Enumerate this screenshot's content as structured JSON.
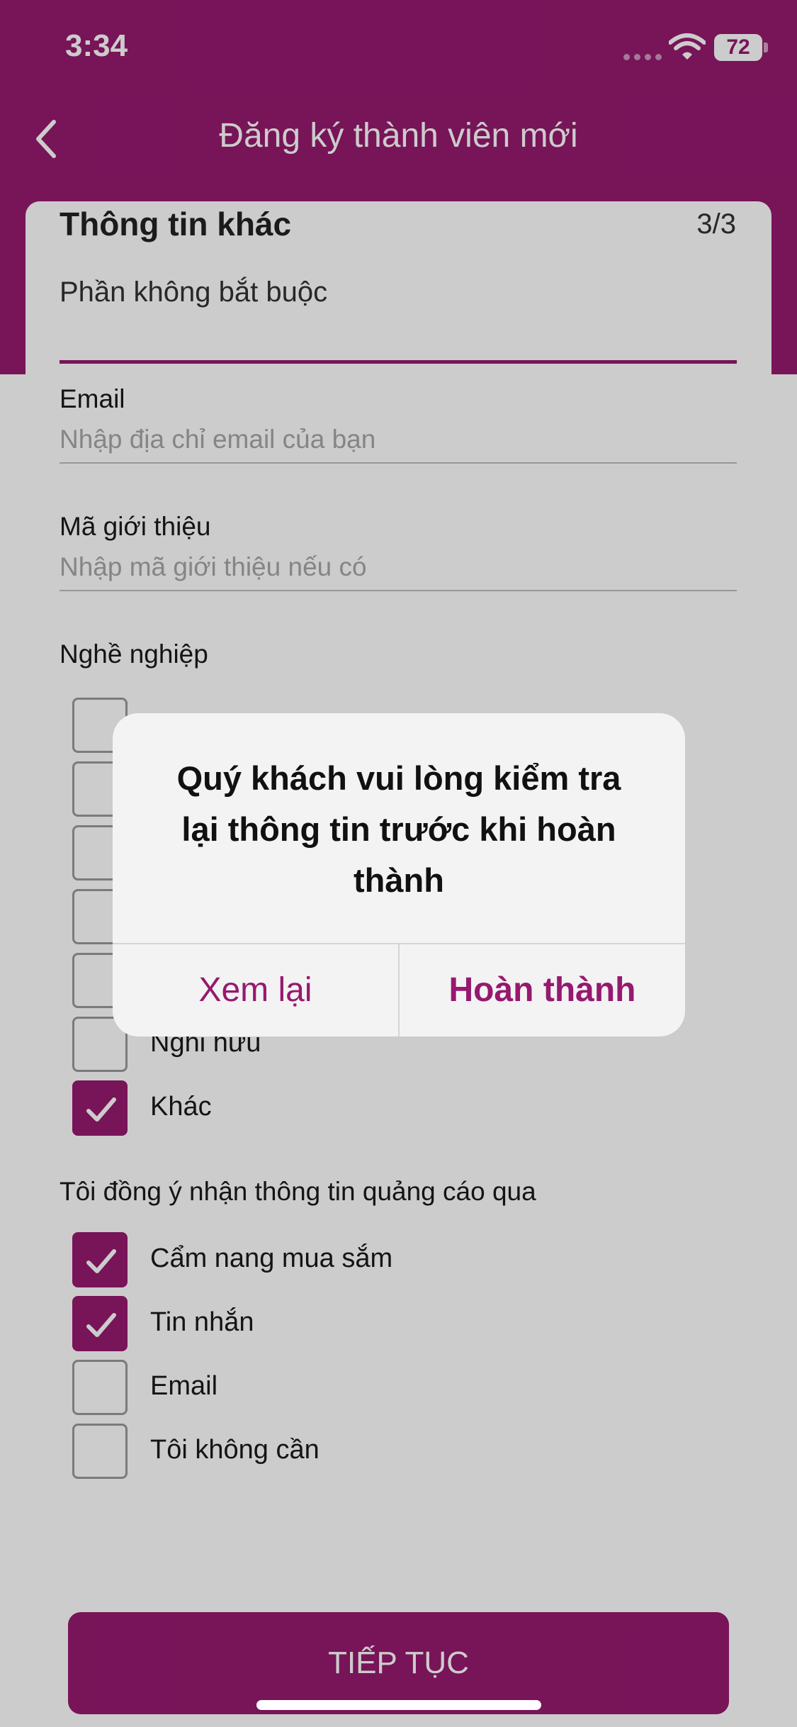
{
  "colors": {
    "brand": "#96196f",
    "overlay": "rgba(0,0,0,0.2)"
  },
  "status_bar": {
    "time": "3:34",
    "battery": "72"
  },
  "nav": {
    "back_icon": "chevron-left-icon",
    "title": "Đăng ký thành viên mới"
  },
  "card": {
    "title": "Thông tin khác",
    "step": "3/3",
    "subtitle": "Phần không bắt buộc",
    "email": {
      "label": "Email",
      "placeholder": "Nhập địa chỉ email của bạn",
      "value": ""
    },
    "referral": {
      "label": "Mã giới thiệu",
      "placeholder": "Nhập mã giới thiệu nếu có",
      "value": ""
    },
    "occupation": {
      "label": "Nghề nghiệp",
      "options": [
        {
          "label": "",
          "checked": false
        },
        {
          "label": "",
          "checked": false
        },
        {
          "label": "",
          "checked": false
        },
        {
          "label": "",
          "checked": false
        },
        {
          "label": "",
          "checked": false
        },
        {
          "label": "Nghỉ hưu",
          "checked": false
        },
        {
          "label": "Khác",
          "checked": true
        }
      ]
    },
    "ads": {
      "label": "Tôi đồng ý nhận thông tin quảng cáo qua",
      "options": [
        {
          "label": "Cẩm nang mua sắm",
          "checked": true
        },
        {
          "label": "Tin nhắn",
          "checked": true
        },
        {
          "label": "Email",
          "checked": false
        },
        {
          "label": "Tôi không cần",
          "checked": false
        }
      ]
    }
  },
  "footer": {
    "continue_label": "TIẾP TỤC"
  },
  "alert": {
    "message": "Quý khách vui lòng kiểm tra lại thông tin trước khi hoàn thành",
    "review_label": "Xem lại",
    "complete_label": "Hoàn thành"
  }
}
